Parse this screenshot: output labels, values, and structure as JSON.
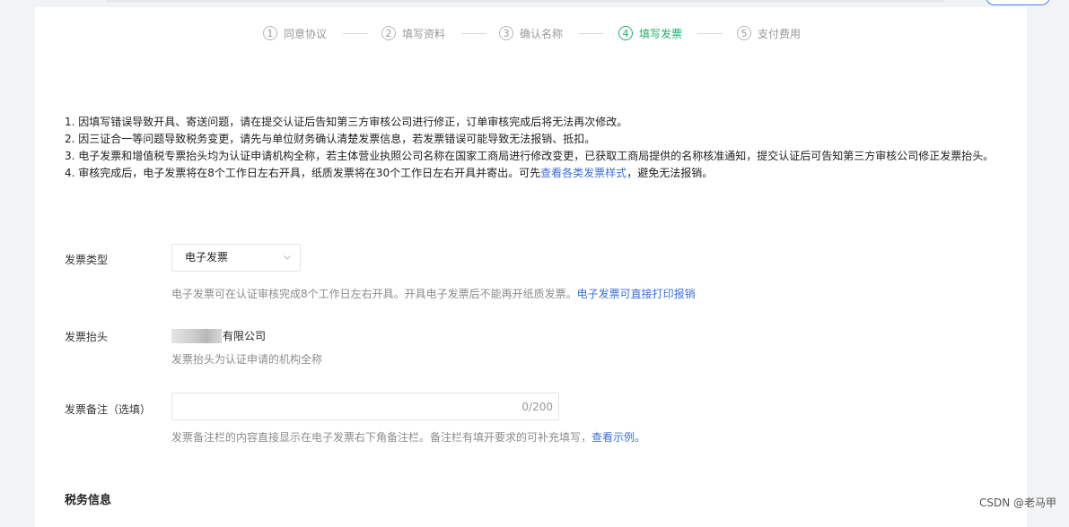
{
  "steps": [
    {
      "num": "1",
      "label": "同意协议",
      "active": false
    },
    {
      "num": "2",
      "label": "填写资料",
      "active": false
    },
    {
      "num": "3",
      "label": "确认名称",
      "active": false
    },
    {
      "num": "4",
      "label": "填写发票",
      "active": true
    },
    {
      "num": "5",
      "label": "支付费用",
      "active": false
    }
  ],
  "notice": {
    "line1": "1. 因填写错误导致开具、寄送问题，请在提交认证后告知第三方审核公司进行修正，订单审核完成后将无法再次修改。",
    "line2": "2. 因三证合一等问题导致税务变更，请先与单位财务确认清楚发票信息，若发票错误可能导致无法报销、抵扣。",
    "line3": "3. 电子发票和增值税专票抬头均为认证申请机构全称，若主体营业执照公司名称在国家工商局进行修改变更，已获取工商局提供的名称核准通知，提交认证后可告知第三方审核公司修正发票抬头。",
    "line4_prefix": "4. 审核完成后，电子发票将在8个工作日左右开具，纸质发票将在30个工作日左右开具并寄出。可先",
    "line4_link": "查看各类发票样式",
    "line4_suffix": "，避免无法报销。"
  },
  "invoice_type": {
    "label": "发票类型",
    "value": "电子发票",
    "hint": "电子发票可在认证审核完成8个工作日左右开具。开具电子发票后不能再开纸质发票。",
    "hint_link": "电子发票可直接打印报销"
  },
  "invoice_title": {
    "label": "发票抬头",
    "value_suffix": "有限公司",
    "hint": "发票抬头为认证申请的机构全称"
  },
  "invoice_remark": {
    "label": "发票备注（选填）",
    "counter": "0/200",
    "hint": "发票备注栏的内容直接显示在电子发票右下角备注栏。备注栏有填开要求的可补充填写，",
    "hint_link": "查看示例。"
  },
  "tax_section": {
    "title": "税务信息"
  },
  "watermark": "CSDN @老马甲",
  "colors": {
    "active_step": "#19b26b",
    "link": "#3d6fd9"
  }
}
